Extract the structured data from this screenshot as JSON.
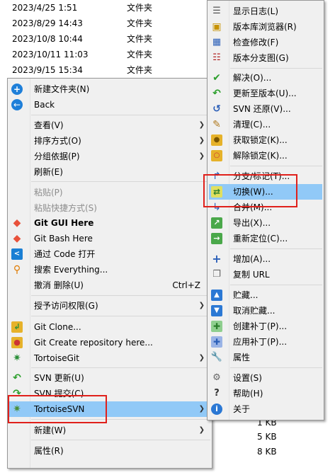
{
  "colors": {
    "highlight": "#91c9f7",
    "annotation": "#e0201b",
    "menu_bg": "#f0f0f0"
  },
  "background_files": {
    "rows": [
      {
        "date": "2023/4/25 1:51",
        "type": "文件夹"
      },
      {
        "date": "2023/8/29 14:43",
        "type": "文件夹"
      },
      {
        "date": "2023/10/8 10:44",
        "type": "文件夹"
      },
      {
        "date": "2023/10/11 11:03",
        "type": "文件夹"
      },
      {
        "date": "2023/9/15 15:34",
        "type": "文件夹"
      }
    ],
    "sizes": [
      "1 KB",
      "5 KB",
      "8 KB"
    ]
  },
  "context_menu": {
    "items": [
      {
        "label": "新建文件夹(N)",
        "icon": "new-folder-icon"
      },
      {
        "label": "Back",
        "icon": "back-icon"
      },
      {
        "label": "查看(V)",
        "submenu": true
      },
      {
        "label": "排序方式(O)",
        "submenu": true
      },
      {
        "label": "分组依据(P)",
        "submenu": true
      },
      {
        "label": "刷新(E)"
      },
      {
        "label": "粘贴(P)",
        "disabled": true
      },
      {
        "label": "粘贴快捷方式(S)",
        "disabled": true
      },
      {
        "label": "Git GUI Here",
        "icon": "git-gui-icon"
      },
      {
        "label": "Git Bash Here",
        "icon": "git-bash-icon"
      },
      {
        "label": "通过 Code 打开",
        "icon": "vscode-icon"
      },
      {
        "label": "搜索 Everything...",
        "icon": "everything-search-icon"
      },
      {
        "label": "撤消 删除(U)",
        "shortcut": "Ctrl+Z"
      },
      {
        "label": "授予访问权限(G)",
        "submenu": true
      },
      {
        "label": "Git Clone...",
        "icon": "git-clone-icon"
      },
      {
        "label": "Git Create repository here...",
        "icon": "git-create-repo-icon"
      },
      {
        "label": "TortoiseGit",
        "icon": "tortoisegit-icon",
        "submenu": true
      },
      {
        "label": "SVN 更新(U)",
        "icon": "svn-update-icon"
      },
      {
        "label": "SVN 提交(C)...",
        "icon": "svn-commit-icon"
      },
      {
        "label": "TortoiseSVN",
        "icon": "tortoisesvn-icon",
        "submenu": true
      },
      {
        "label": "新建(W)",
        "submenu": true
      },
      {
        "label": "属性(R)"
      }
    ]
  },
  "svn_submenu": {
    "items": [
      {
        "label": "显示日志(L)",
        "icon": "show-log-icon"
      },
      {
        "label": "版本库浏览器(R)",
        "icon": "repo-browser-icon"
      },
      {
        "label": "检查修改(F)",
        "icon": "check-modifications-icon"
      },
      {
        "label": "版本分支图(G)",
        "icon": "revision-graph-icon"
      },
      {
        "label": "解决(O)...",
        "icon": "resolve-icon"
      },
      {
        "label": "更新至版本(U)...",
        "icon": "update-to-revision-icon"
      },
      {
        "label": "SVN 还原(V)...",
        "icon": "revert-icon"
      },
      {
        "label": "清理(C)...",
        "icon": "cleanup-icon"
      },
      {
        "label": "获取锁定(K)...",
        "icon": "get-lock-icon"
      },
      {
        "label": "解除锁定(K)...",
        "icon": "release-lock-icon"
      },
      {
        "label": "分支/标记(T)...",
        "icon": "branch-tag-icon"
      },
      {
        "label": "切换(W)...",
        "icon": "switch-icon"
      },
      {
        "label": "合并(M)...",
        "icon": "merge-icon"
      },
      {
        "label": "导出(X)...",
        "icon": "export-icon"
      },
      {
        "label": "重新定位(C)...",
        "icon": "relocate-icon"
      },
      {
        "label": "增加(A)...",
        "icon": "add-icon"
      },
      {
        "label": "复制 URL",
        "icon": "copy-url-icon"
      },
      {
        "label": "贮藏...",
        "icon": "shelve-icon"
      },
      {
        "label": "取消贮藏...",
        "icon": "unshelve-icon"
      },
      {
        "label": "创建补丁(P)...",
        "icon": "create-patch-icon"
      },
      {
        "label": "应用补丁(P)...",
        "icon": "apply-patch-icon"
      },
      {
        "label": "属性",
        "icon": "properties-icon"
      },
      {
        "label": "设置(S)",
        "icon": "settings-icon"
      },
      {
        "label": "帮助(H)",
        "icon": "help-icon"
      },
      {
        "label": "关于",
        "icon": "about-icon"
      }
    ]
  }
}
